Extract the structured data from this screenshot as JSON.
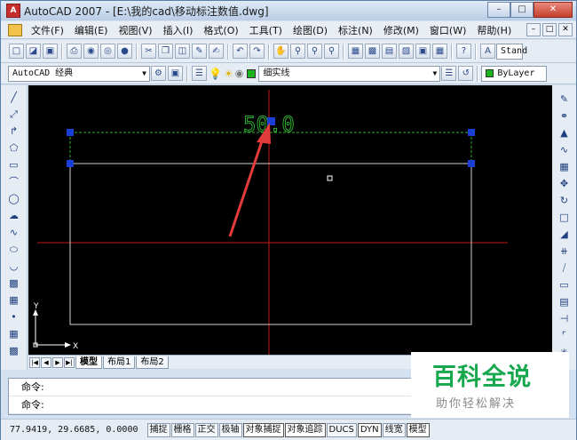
{
  "window": {
    "title": "AutoCAD 2007 - [E:\\我的cad\\移动标注数值.dwg]",
    "app_icon": "A"
  },
  "menu": {
    "items": [
      "文件(F)",
      "编辑(E)",
      "视图(V)",
      "插入(I)",
      "格式(O)",
      "工具(T)",
      "绘图(D)",
      "标注(N)",
      "修改(M)",
      "窗口(W)",
      "帮助(H)"
    ]
  },
  "toolbar2": {
    "workspace": "AutoCAD 经典",
    "layer": "细实线",
    "color": "ByLayer",
    "style_text": "Stand"
  },
  "drawing": {
    "dimension_text": "50.0"
  },
  "tabs": [
    "模型",
    "布局1",
    "布局2"
  ],
  "command": {
    "line1": "命令:",
    "line2": "命令:"
  },
  "status": {
    "coords": "77.9419,  29.6685, 0.0000",
    "toggles": [
      "捕捉",
      "栅格",
      "正交",
      "极轴",
      "对象捕捉",
      "对象追踪",
      "DUCS",
      "DYN",
      "线宽",
      "模型"
    ]
  },
  "watermark": {
    "title": "百科全说",
    "subtitle": "助你轻松解决"
  },
  "colors": {
    "canvas": "#000000",
    "grip": "#1a3fd6",
    "dimension": "#2fae2f",
    "crosshair": "#c01818",
    "arrow": "#e23b3b"
  }
}
